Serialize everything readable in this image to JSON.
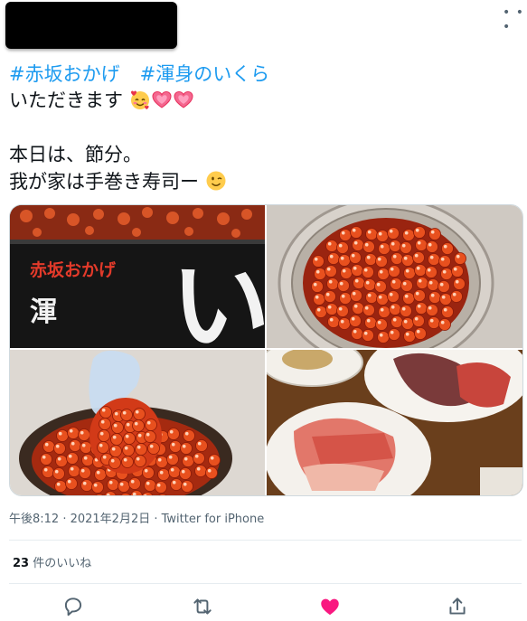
{
  "tweet": {
    "hashtags": [
      "#赤坂おかげ",
      "#渾身のいくら"
    ],
    "line1": "いただきます",
    "line2": "本日は、節分。",
    "line3": "我が家は手巻き寿司ー",
    "emojis": [
      "smiling-face-with-hearts",
      "pink-heart",
      "pink-heart",
      "winking-face"
    ],
    "photo_text": {
      "brand": "赤坂おかげ",
      "jar_label": "渾",
      "jar_glyph": "い"
    },
    "timestamp": "午後8:12 · 2021年2月2日",
    "separator": " · ",
    "source": "Twitter for iPhone",
    "likes_count": "23",
    "likes_label": " 件のいいね"
  },
  "colors": {
    "hashtag": "#1d9bf0",
    "liked": "#f91880",
    "muted": "#536471"
  },
  "icons": [
    "more-options-icon",
    "reply-icon",
    "retweet-icon",
    "like-icon",
    "share-icon"
  ]
}
